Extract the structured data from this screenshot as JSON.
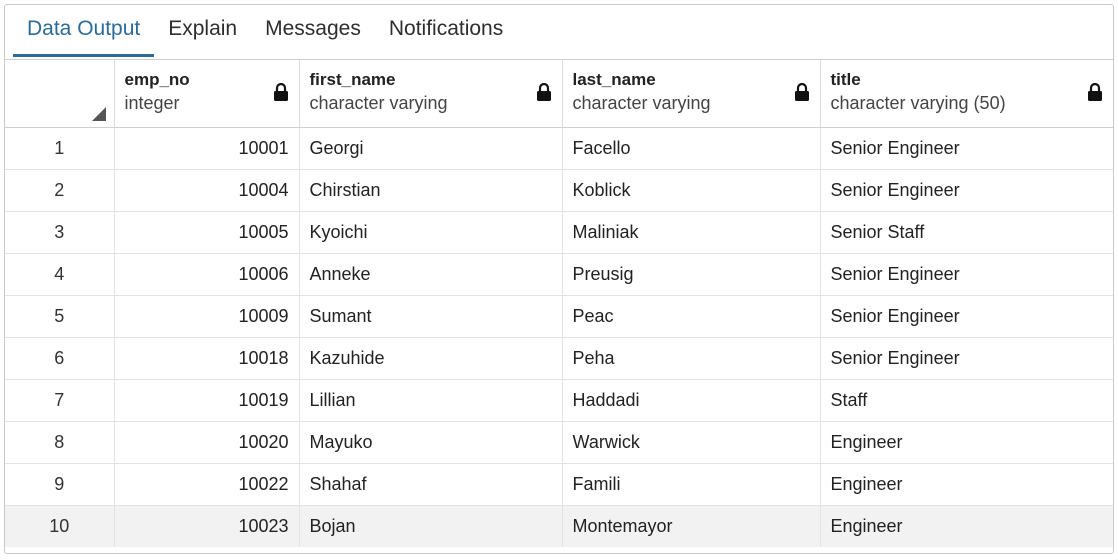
{
  "tabs": [
    {
      "label": "Data Output",
      "active": true
    },
    {
      "label": "Explain",
      "active": false
    },
    {
      "label": "Messages",
      "active": false
    },
    {
      "label": "Notifications",
      "active": false
    }
  ],
  "columns": [
    {
      "name": "emp_no",
      "type": "integer",
      "icon": "lock-icon"
    },
    {
      "name": "first_name",
      "type": "character varying",
      "icon": "lock-icon"
    },
    {
      "name": "last_name",
      "type": "character varying",
      "icon": "lock-icon"
    },
    {
      "name": "title",
      "type": "character varying (50)",
      "icon": "lock-icon"
    }
  ],
  "rows": [
    {
      "n": "1",
      "emp_no": "10001",
      "first_name": "Georgi",
      "last_name": "Facello",
      "title": "Senior Engineer"
    },
    {
      "n": "2",
      "emp_no": "10004",
      "first_name": "Chirstian",
      "last_name": "Koblick",
      "title": "Senior Engineer"
    },
    {
      "n": "3",
      "emp_no": "10005",
      "first_name": "Kyoichi",
      "last_name": "Maliniak",
      "title": "Senior Staff"
    },
    {
      "n": "4",
      "emp_no": "10006",
      "first_name": "Anneke",
      "last_name": "Preusig",
      "title": "Senior Engineer"
    },
    {
      "n": "5",
      "emp_no": "10009",
      "first_name": "Sumant",
      "last_name": "Peac",
      "title": "Senior Engineer"
    },
    {
      "n": "6",
      "emp_no": "10018",
      "first_name": "Kazuhide",
      "last_name": "Peha",
      "title": "Senior Engineer"
    },
    {
      "n": "7",
      "emp_no": "10019",
      "first_name": "Lillian",
      "last_name": "Haddadi",
      "title": "Staff"
    },
    {
      "n": "8",
      "emp_no": "10020",
      "first_name": "Mayuko",
      "last_name": "Warwick",
      "title": "Engineer"
    },
    {
      "n": "9",
      "emp_no": "10022",
      "first_name": "Shahaf",
      "last_name": "Famili",
      "title": "Engineer"
    },
    {
      "n": "10",
      "emp_no": "10023",
      "first_name": "Bojan",
      "last_name": "Montemayor",
      "title": "Engineer"
    }
  ],
  "colors": {
    "accent": "#2c6b97"
  }
}
